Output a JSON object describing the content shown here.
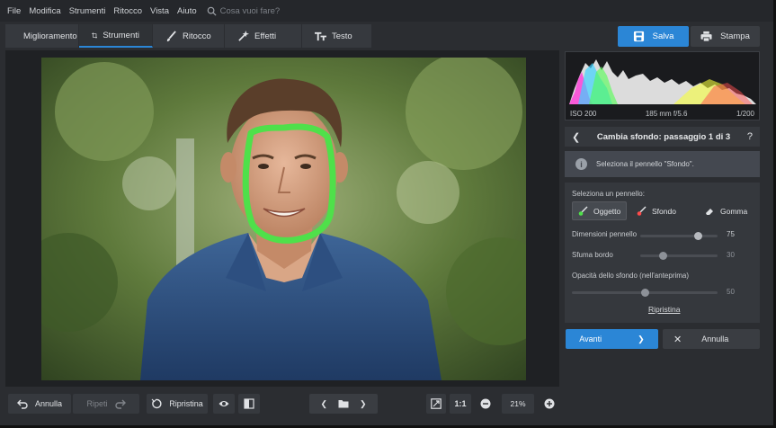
{
  "menu": [
    "File",
    "Modifica",
    "Strumenti",
    "Ritocco",
    "Vista",
    "Aiuto"
  ],
  "search": {
    "placeholder": "Cosa vuoi fare?"
  },
  "tabs": [
    {
      "label": "Miglioramento",
      "icon": "sliders-icon"
    },
    {
      "label": "Strumenti",
      "icon": "crop-icon"
    },
    {
      "label": "Ritocco",
      "icon": "brush-icon"
    },
    {
      "label": "Effetti",
      "icon": "magic-wand-icon"
    },
    {
      "label": "Testo",
      "icon": "text-icon"
    }
  ],
  "actions": {
    "save": "Salva",
    "print": "Stampa"
  },
  "exif": {
    "iso": "ISO 200",
    "lens": "185 mm f/5.6",
    "shutter": "1/200"
  },
  "step": {
    "title": "Cambia sfondo: passaggio 1 di 3",
    "help": "?"
  },
  "info": {
    "message": "Seleziona il pennello \"Sfondo\"."
  },
  "brush_section": {
    "label": "Seleziona un pennello:",
    "brushes": [
      "Oggetto",
      "Sfondo",
      "Gomma"
    ],
    "selected": "Oggetto"
  },
  "sliders": [
    {
      "label": "Dimensioni pennello",
      "value": "75",
      "fraction": 0.75
    },
    {
      "label": "Sfuma bordo",
      "value": "30",
      "fraction": 0.3
    },
    {
      "label": "Opacità dello sfondo (nell'anteprima)",
      "value": "50",
      "fraction": 0.5
    }
  ],
  "reset": "Ripristina",
  "footer": {
    "next": "Avanti",
    "cancel": "Annulla"
  },
  "bottom": {
    "undo": "Annulla",
    "redo": "Ripeti",
    "restore": "Ripristina",
    "fit": "1:1",
    "zoom": "21%"
  },
  "colors": {
    "accent": "#2b86d6",
    "selection": "#4fe04a"
  }
}
